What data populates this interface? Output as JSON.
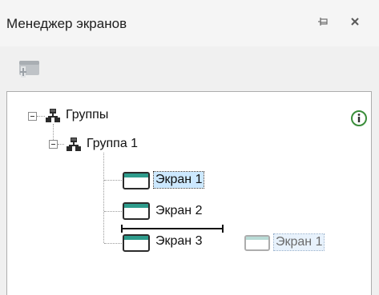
{
  "panel": {
    "title": "Менеджер экранов"
  },
  "tree": {
    "root": {
      "label": "Группы"
    },
    "group": {
      "label": "Группа 1"
    },
    "screens": [
      {
        "label": "Экран 1",
        "selected": true
      },
      {
        "label": "Экран 2",
        "selected": false
      },
      {
        "label": "Экран 3",
        "selected": false
      }
    ],
    "drag_ghost": {
      "label": "Экран 1"
    }
  },
  "icons": {
    "pin": "pin-icon",
    "close": "close-icon",
    "add_screen": "add-screen-icon",
    "group": "network-group-icon",
    "screen": "window-icon",
    "info": "info-icon"
  },
  "colors": {
    "screen_icon_accent": "#2e9c8c",
    "selection": "#cce8ff",
    "info_ring": "#3a8d3a"
  }
}
